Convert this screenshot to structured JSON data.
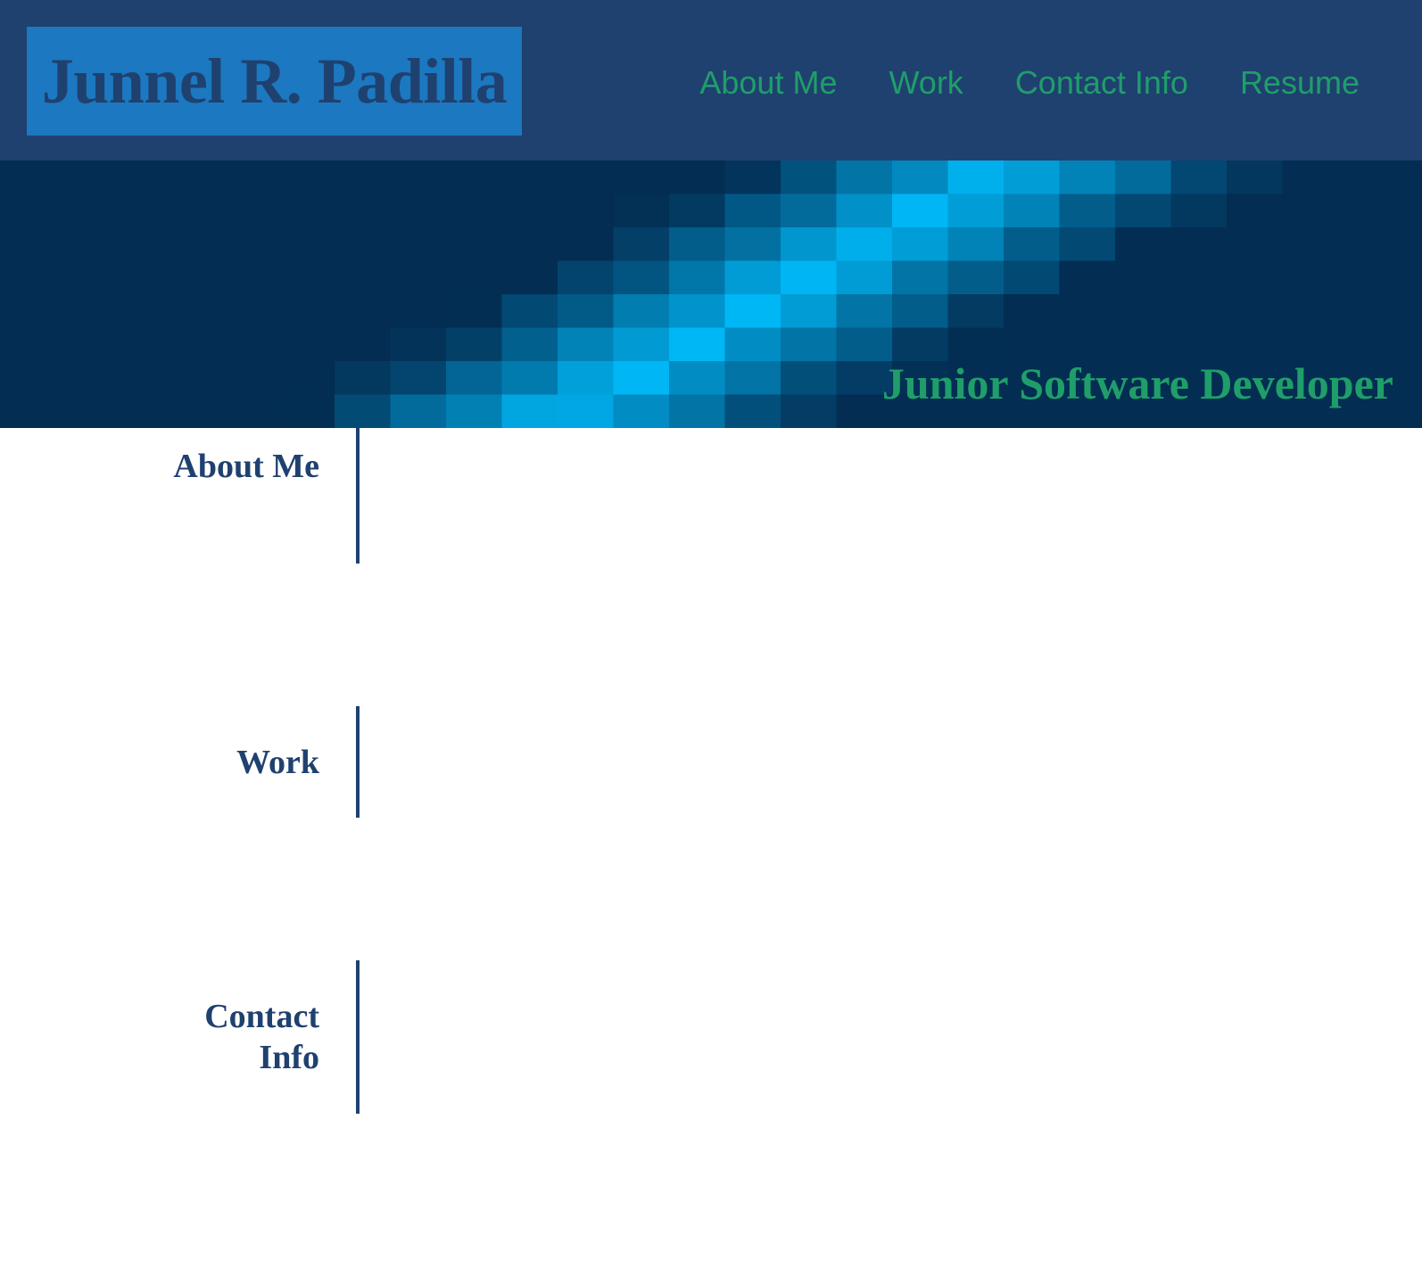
{
  "header": {
    "logo_text": "Junnel R. Padilla",
    "nav": [
      {
        "label": "About Me"
      },
      {
        "label": "Work"
      },
      {
        "label": "Contact Info"
      },
      {
        "label": "Resume"
      }
    ]
  },
  "banner": {
    "tagline": "Junior Software Developer"
  },
  "sections": [
    {
      "label": "About Me"
    },
    {
      "label": "Work"
    },
    {
      "label": "Contact Info"
    }
  ],
  "colors": {
    "header_bg": "#1f416f",
    "logo_bg": "#1c78c0",
    "accent_green": "#1f9e6a",
    "banner_bright": "#00bfff",
    "banner_dark": "#032d52"
  }
}
